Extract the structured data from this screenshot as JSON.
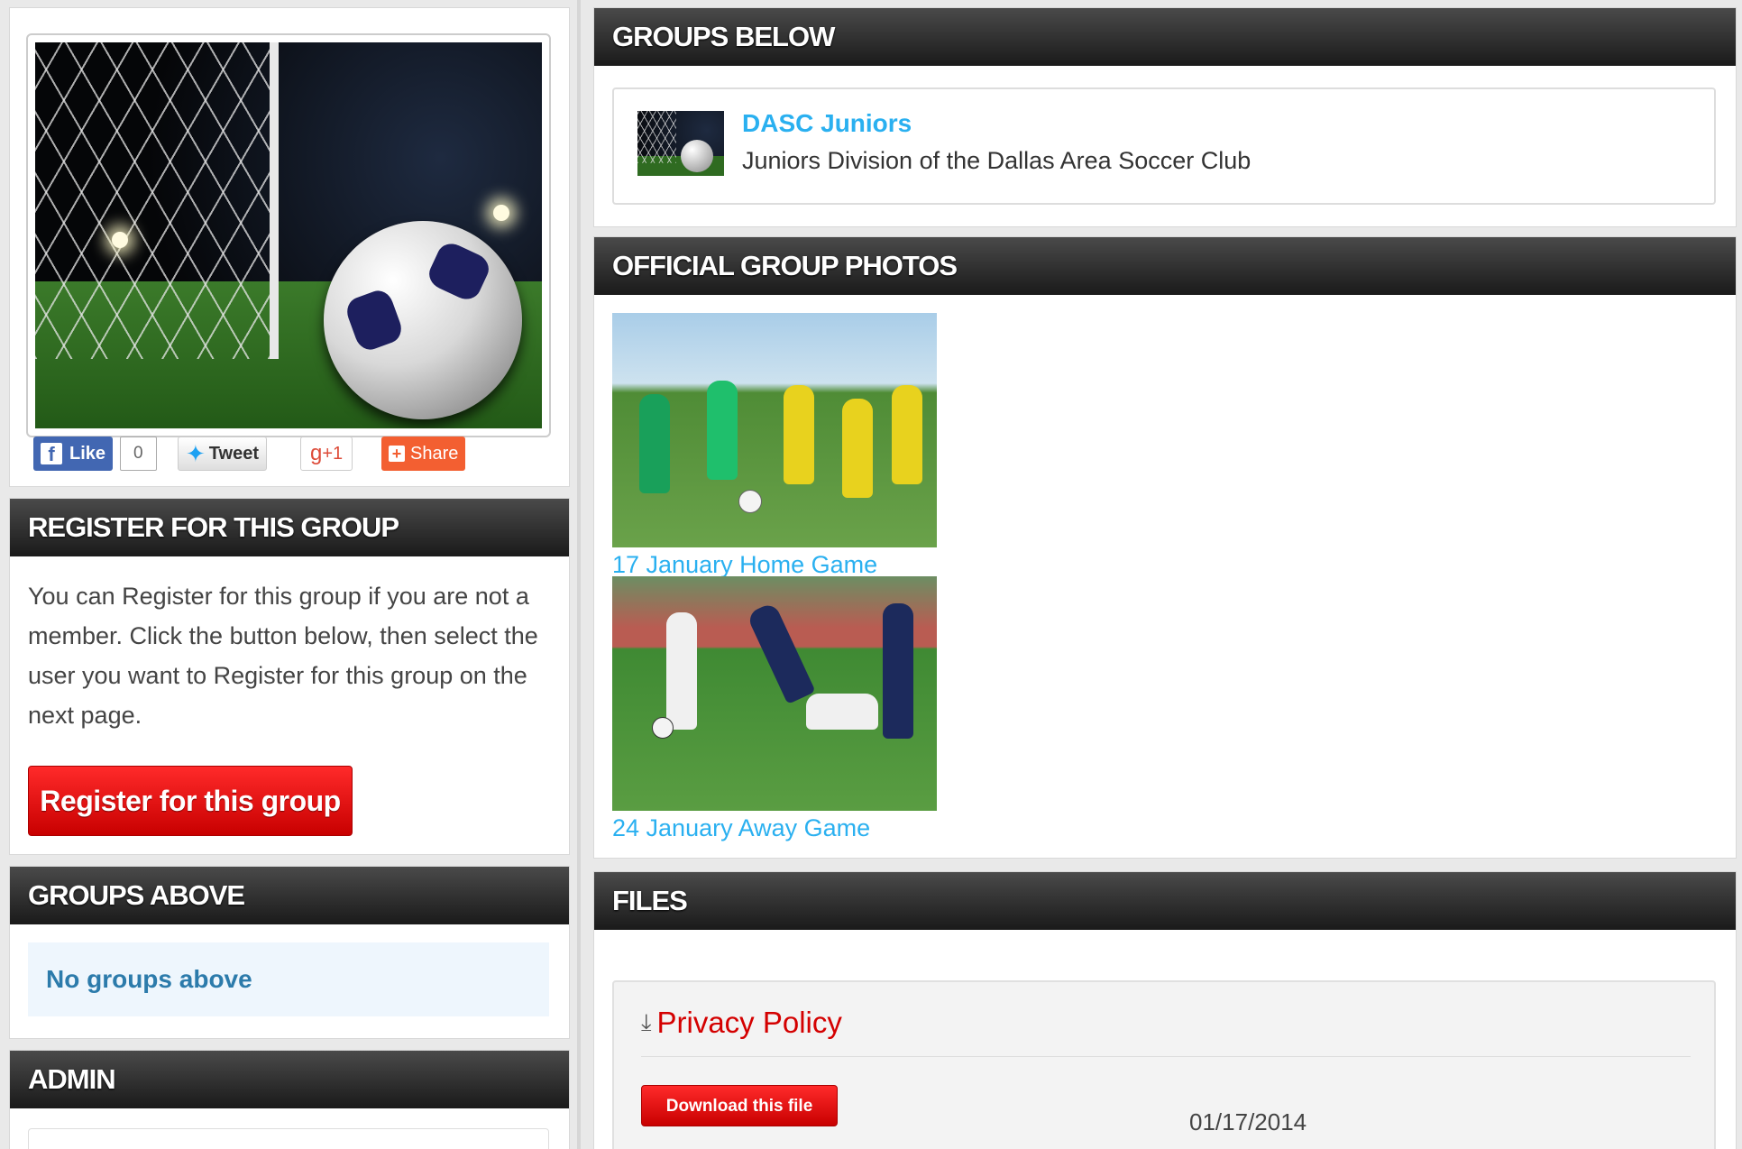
{
  "social": {
    "like_label": "Like",
    "like_count": "0",
    "tweet_label": "Tweet",
    "gplus_label": "+1",
    "share_label": "Share"
  },
  "register": {
    "header": "Register for this group",
    "text": "You can Register for this group if you are not a member. Click the button below, then select the user you want to Register for this group on the next page.",
    "button_label": "Register for this group"
  },
  "groups_above": {
    "header": "Groups above",
    "empty_text": "No groups above"
  },
  "admin": {
    "header": "Admin"
  },
  "groups_below": {
    "header": "Groups below",
    "items": [
      {
        "title": "DASC Juniors",
        "description": "Juniors Division of the Dallas Area Soccer Club"
      }
    ]
  },
  "photos": {
    "header": "Official group photos",
    "items": [
      {
        "caption": "17 January Home Game"
      },
      {
        "caption": "24 January Away Game"
      }
    ]
  },
  "files": {
    "header": "Files",
    "items": [
      {
        "name": "Privacy Policy",
        "download_label": "Download this file",
        "date": "01/17/2014"
      }
    ]
  },
  "colors": {
    "link_blue": "#2ab0f0",
    "accent_red": "#d40000",
    "header_dark": "#1a1a1a"
  }
}
